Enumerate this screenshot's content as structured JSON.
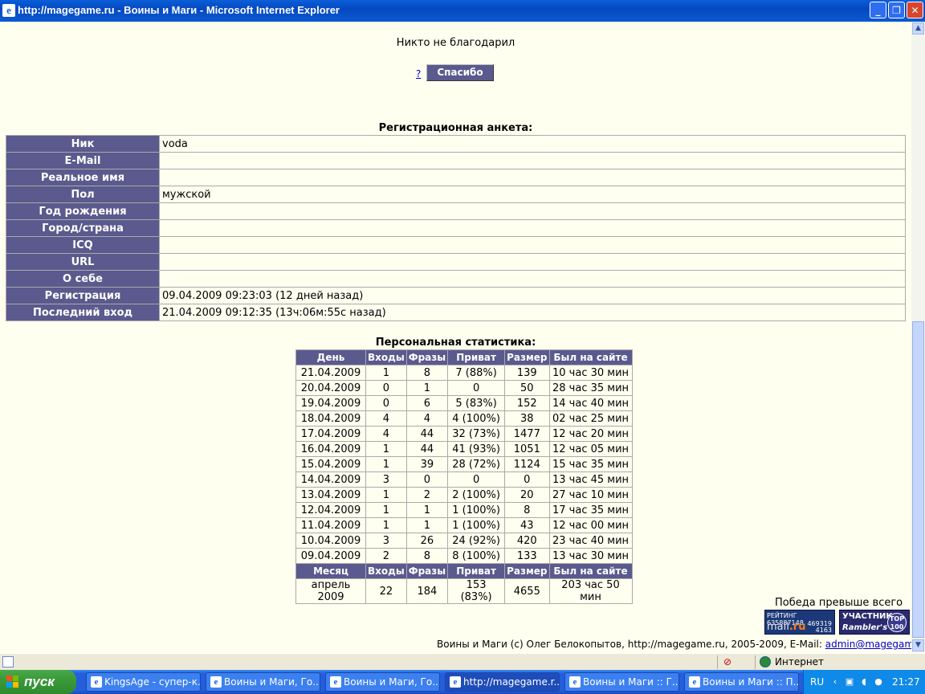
{
  "window": {
    "title": "http://magegame.ru - Воины и Маги - Microsoft Internet Explorer",
    "minimize": "_",
    "maximize": "❐",
    "close": "✕"
  },
  "page": {
    "thanks_status": "Никто не благодарил",
    "help_link": "?",
    "thanks_button": "Спасибо",
    "reg_title": "Регистрационная анкета:",
    "reg_fields": [
      {
        "label": "Ник",
        "value": "voda"
      },
      {
        "label": "E-Mail",
        "value": ""
      },
      {
        "label": "Реальное имя",
        "value": ""
      },
      {
        "label": "Пол",
        "value": "мужской"
      },
      {
        "label": "Год рождения",
        "value": ""
      },
      {
        "label": "Город/страна",
        "value": ""
      },
      {
        "label": "ICQ",
        "value": ""
      },
      {
        "label": "URL",
        "value": ""
      },
      {
        "label": "О себе",
        "value": ""
      },
      {
        "label": "Регистрация",
        "value": "09.04.2009 09:23:03 (12 дней назад)"
      },
      {
        "label": "Последний вход",
        "value": "21.04.2009 09:12:35 (13ч:06м:55с назад)"
      }
    ],
    "stats_title": "Персональная статистика:",
    "stats_headers": [
      "День",
      "Входы",
      "Фразы",
      "Приват",
      "Размер",
      "Был на сайте"
    ],
    "stats_rows": [
      [
        "21.04.2009",
        "1",
        "8",
        "7 (88%)",
        "139",
        "10 час 30 мин"
      ],
      [
        "20.04.2009",
        "0",
        "1",
        "0",
        "50",
        "28 час 35 мин"
      ],
      [
        "19.04.2009",
        "0",
        "6",
        "5 (83%)",
        "152",
        "14 час 40 мин"
      ],
      [
        "18.04.2009",
        "4",
        "4",
        "4 (100%)",
        "38",
        "02 час 25 мин"
      ],
      [
        "17.04.2009",
        "4",
        "44",
        "32 (73%)",
        "1477",
        "12 час 20 мин"
      ],
      [
        "16.04.2009",
        "1",
        "44",
        "41 (93%)",
        "1051",
        "12 час 05 мин"
      ],
      [
        "15.04.2009",
        "1",
        "39",
        "28 (72%)",
        "1124",
        "15 час 35 мин"
      ],
      [
        "14.04.2009",
        "3",
        "0",
        "0",
        "0",
        "13 час 45 мин"
      ],
      [
        "13.04.2009",
        "1",
        "2",
        "2 (100%)",
        "20",
        "27 час 10 мин"
      ],
      [
        "12.04.2009",
        "1",
        "1",
        "1 (100%)",
        "8",
        "17 час 35 мин"
      ],
      [
        "11.04.2009",
        "1",
        "1",
        "1 (100%)",
        "43",
        "12 час 00 мин"
      ],
      [
        "10.04.2009",
        "3",
        "26",
        "24 (92%)",
        "420",
        "23 час 40 мин"
      ],
      [
        "09.04.2009",
        "2",
        "8",
        "8 (100%)",
        "133",
        "13 час 30 мин"
      ]
    ],
    "month_headers": [
      "Месяц",
      "Входы",
      "Фразы",
      "Приват",
      "Размер",
      "Был на сайте"
    ],
    "month_row": [
      "апрель 2009",
      "22",
      "184",
      "153 (83%)",
      "4655",
      "203 час 50 мин"
    ],
    "motto": "Победа превыше всего",
    "badge_mail": {
      "line1": "РЕЙТИНГ 635887148",
      "brand": "mail",
      "brand_tld": ".ru",
      "num1": "469319",
      "num2": "4163"
    },
    "badge_rambler": {
      "line1": "УЧАСТНИК",
      "line2": "Rambler's",
      "top1": "TOP",
      "top2": "100"
    },
    "footer_text": "Воины и Маги (c) Олег Белокопытов, http://magegame.ru, 2005-2009, E-Mail: ",
    "footer_email": "admin@magegame.ru"
  },
  "statusbar": {
    "zone": "Интернет"
  },
  "taskbar": {
    "start": "пуск",
    "tasks": [
      "KingsAge - супер-к...",
      "Воины и Маги, Го...",
      "Воины и Маги, Го...",
      "http://magegame.r...",
      "Воины и Маги :: Г...",
      "Воины и Маги :: П..."
    ],
    "lang": "RU",
    "clock": "21:27"
  },
  "colors": {
    "header_bg": "#5a5a8e",
    "page_bg": "#fffff0",
    "link": "#0000cc",
    "taskbar": "#245edb",
    "start": "#3a9a3a"
  }
}
